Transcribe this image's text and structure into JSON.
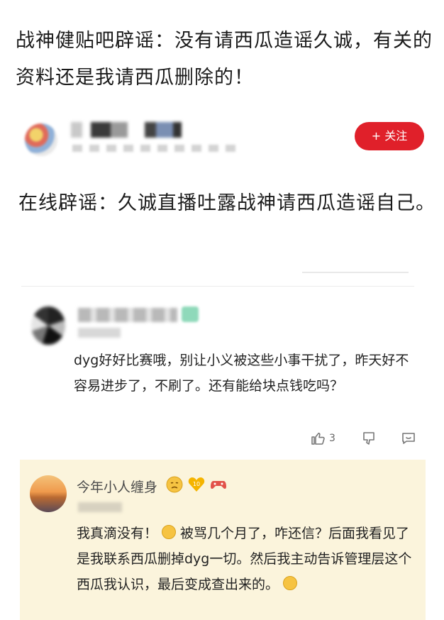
{
  "post": {
    "headline": "战神健贴吧辟谣：没有请西瓜造谣久诚，有关的资料还是我请西瓜删除的！",
    "follow_label": "+ 关注",
    "body": "在线辟谣：久诚直播吐露战神请西瓜造谣自己。"
  },
  "comment1": {
    "text": "dyg好好比赛哦，别让小义被这些小事干扰了，昨天好不容易进步了，不刷了。还有能给块点钱吃吗？",
    "like_count": "3"
  },
  "comment2": {
    "username": "今年小人缠身",
    "text_part1": "我真滴没有！",
    "text_part2": "被骂几个月了，咋还信？后面我看见了 是我联系西瓜删掉dyg一切。然后我主动告诉管理层这个西瓜我认识，最后变成查出来的。"
  },
  "colors": {
    "accent_red": "#e0202a",
    "highlight_bg": "#fbf4dc"
  },
  "icons": [
    "thumbs-up-icon",
    "dislike-icon",
    "reply-icon",
    "sad-face-icon",
    "heart-badge-icon",
    "game-controller-icon",
    "clapping-emoji-icon",
    "astonished-emoji-icon"
  ]
}
